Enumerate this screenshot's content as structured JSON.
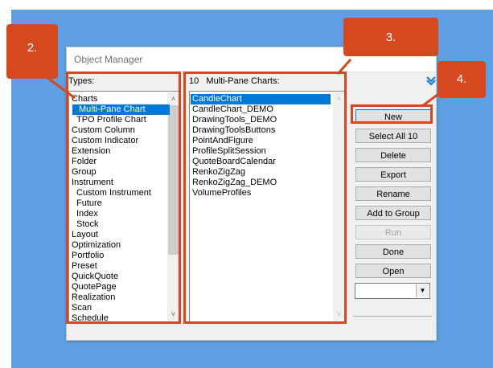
{
  "window": {
    "title": "Object Manager"
  },
  "types_panel": {
    "header": "Types:",
    "items": [
      {
        "label": "Charts",
        "indent": 0
      },
      {
        "label": "Multi-Pane Chart",
        "indent": 1,
        "selected": true
      },
      {
        "label": "TPO Profile Chart",
        "indent": 1
      },
      {
        "label": "Custom Column",
        "indent": 0
      },
      {
        "label": "Custom Indicator",
        "indent": 0
      },
      {
        "label": "Extension",
        "indent": 0
      },
      {
        "label": "Folder",
        "indent": 0
      },
      {
        "label": "Group",
        "indent": 0
      },
      {
        "label": "Instrument",
        "indent": 0
      },
      {
        "label": "Custom Instrument",
        "indent": 1
      },
      {
        "label": "Future",
        "indent": 1
      },
      {
        "label": "Index",
        "indent": 1
      },
      {
        "label": "Stock",
        "indent": 1
      },
      {
        "label": "Layout",
        "indent": 0
      },
      {
        "label": "Optimization",
        "indent": 0
      },
      {
        "label": "Portfolio",
        "indent": 0
      },
      {
        "label": "Preset",
        "indent": 0
      },
      {
        "label": "QuickQuote",
        "indent": 0
      },
      {
        "label": "QuotePage",
        "indent": 0
      },
      {
        "label": "Realization",
        "indent": 0
      },
      {
        "label": "Scan",
        "indent": 0
      },
      {
        "label": "Schedule",
        "indent": 0
      }
    ]
  },
  "objects_panel": {
    "count": "10",
    "header": "Multi-Pane Charts:",
    "items": [
      {
        "label": "CandleChart",
        "selected": true
      },
      {
        "label": "CandleChart_DEMO"
      },
      {
        "label": "DrawingTools_DEMO"
      },
      {
        "label": "DrawingToolsButtons"
      },
      {
        "label": "PointAndFigure"
      },
      {
        "label": "ProfileSplitSession"
      },
      {
        "label": "QuoteBoardCalendar"
      },
      {
        "label": "RenkoZigZag"
      },
      {
        "label": "RenkoZigZag_DEMO"
      },
      {
        "label": "VolumeProfiles"
      }
    ]
  },
  "buttons": {
    "new": "New",
    "select_all": "Select All 10",
    "delete": "Delete",
    "export": "Export",
    "rename": "Rename",
    "add_to_group": "Add to Group",
    "run": "Run",
    "done": "Done",
    "open": "Open"
  },
  "combo": {
    "value": ""
  },
  "icons": {
    "collapse": "chevron-double-down-icon",
    "scroll_up": "chevron-up-icon",
    "scroll_down": "chevron-down-icon",
    "dropdown": "chevron-down-icon"
  },
  "callouts": {
    "c2": "2.",
    "c3": "3.",
    "c4": "4."
  },
  "colors": {
    "background": "#5d9fe2",
    "highlight": "#d6481f",
    "selection": "#0078d7"
  }
}
